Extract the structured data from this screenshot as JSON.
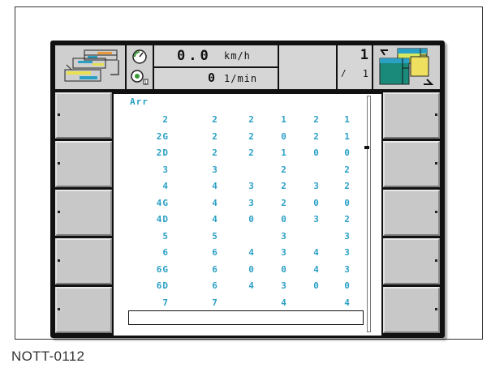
{
  "caption": "NOTT-0112",
  "header": {
    "speed_value": "0.0",
    "speed_unit": "km/h",
    "rpm_value": "0",
    "rpm_unit": "1/min",
    "counter_value": "1",
    "counter_sub": "1"
  },
  "icons": {
    "left_header": "hitch-implement-icon",
    "speedometer": "speedometer-icon",
    "pto": "pto-shaft-icon",
    "right_header": "page-switch-icon"
  },
  "colors": {
    "table_text": "#2aa0c4",
    "softkey": "#c8c8c8",
    "screen_bg": "#111111"
  },
  "table": {
    "header_label": "Arr",
    "rows": [
      {
        "label": "2",
        "cells": [
          "2",
          "2",
          "1",
          "2",
          "1"
        ]
      },
      {
        "label": "2G",
        "cells": [
          "2",
          "2",
          "0",
          "2",
          "1"
        ]
      },
      {
        "label": "2D",
        "cells": [
          "2",
          "2",
          "1",
          "0",
          "0"
        ]
      },
      {
        "label": "3",
        "cells": [
          "3",
          "",
          "2",
          "",
          "2"
        ]
      },
      {
        "label": "4",
        "cells": [
          "4",
          "3",
          "2",
          "3",
          "2"
        ]
      },
      {
        "label": "4G",
        "cells": [
          "4",
          "3",
          "2",
          "0",
          "0"
        ]
      },
      {
        "label": "4D",
        "cells": [
          "4",
          "0",
          "0",
          "3",
          "2"
        ]
      },
      {
        "label": "5",
        "cells": [
          "5",
          "",
          "3",
          "",
          "3"
        ]
      },
      {
        "label": "6",
        "cells": [
          "6",
          "4",
          "3",
          "4",
          "3"
        ]
      },
      {
        "label": "6G",
        "cells": [
          "6",
          "0",
          "0",
          "4",
          "3"
        ]
      },
      {
        "label": "6D",
        "cells": [
          "6",
          "4",
          "3",
          "0",
          "0"
        ]
      },
      {
        "label": "7",
        "cells": [
          "7",
          "",
          "4",
          "",
          "4"
        ]
      }
    ]
  }
}
